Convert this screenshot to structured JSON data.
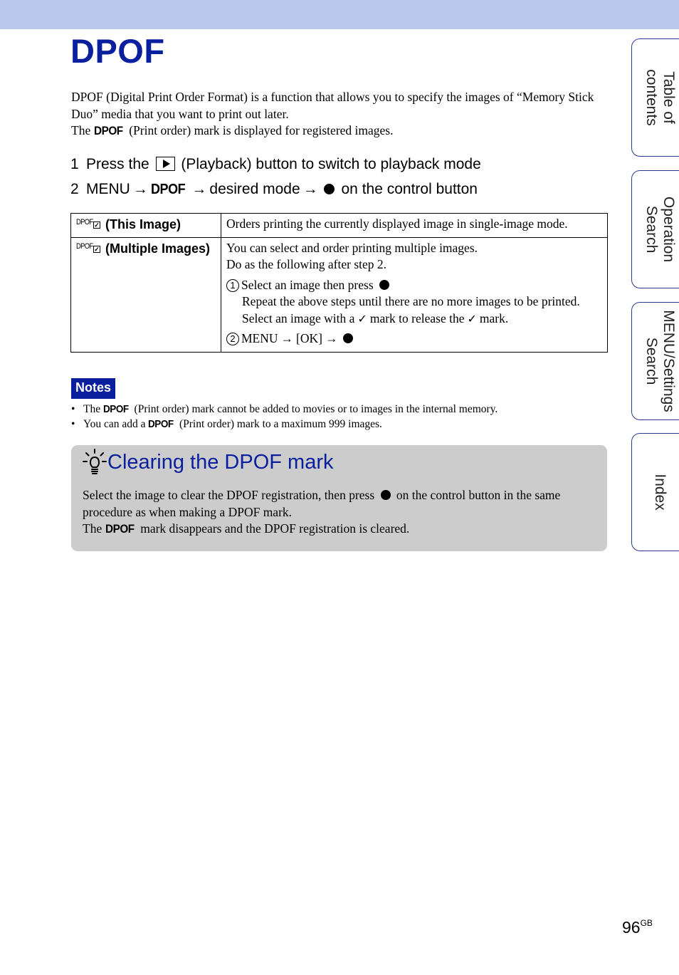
{
  "page": {
    "title": "DPOF",
    "page_number": "96",
    "page_suffix": "GB",
    "colors": {
      "header_band": "#b8c8ec",
      "title_blue": "#0a1f9e",
      "hint_box": "#cccccc"
    }
  },
  "intro": {
    "line1": "DPOF (Digital Print Order Format) is a function that allows you to specify the images of “Memory Stick Duo” media that you want to print out later.",
    "line2_before": "The ",
    "dpof_mark": "DPOF",
    "line2_after": " (Print order) mark is displayed for registered images."
  },
  "steps": [
    {
      "num": "1",
      "before": "Press the ",
      "icon": "playback-icon",
      "after": " (Playback) button to switch to playback mode"
    },
    {
      "num": "2",
      "part1": "MENU",
      "arrow": "→",
      "mark": "DPOF",
      "part2": "desired mode",
      "part3": "on the control button"
    }
  ],
  "table": {
    "rows": [
      {
        "icon_text": "DPOF",
        "name": "(This Image)",
        "desc": "Orders printing the currently displayed image in single-image mode."
      },
      {
        "icon_text": "DPOF",
        "name": "(Multiple Images)",
        "desc_line1": "You can select and order printing multiple images.",
        "desc_line2": "Do as the following after step 2.",
        "sub1_num": "1",
        "sub1_text": "Select an image then press",
        "sub1_cont_before": "Repeat the above steps until there are no more images to be printed. Select an image with a",
        "sub1_cont_mid": "mark to release the",
        "sub1_cont_after": "mark.",
        "sub2_num": "2",
        "sub2_menu": "MENU",
        "sub2_ok": "[OK]"
      }
    ]
  },
  "notes": {
    "label": "Notes",
    "items": [
      {
        "before": "The ",
        "mark": "DPOF",
        "after": " (Print order) mark cannot be added to movies or to images in the internal memory."
      },
      {
        "before": "You can add a ",
        "mark": "DPOF",
        "after": " (Print order) mark to a maximum 999 images."
      }
    ]
  },
  "hint": {
    "title": "Clearing the DPOF mark",
    "icon": "lightbulb-icon",
    "body1": "Select the image to clear the DPOF registration, then press",
    "body1_after": "on the control button in the same procedure as when making a DPOF mark.",
    "body2_before": "The ",
    "body2_mark": "DPOF",
    "body2_after": " mark disappears and the DPOF registration is cleared."
  },
  "side_tabs": [
    {
      "label_line1": "Table of",
      "label_line2": "contents"
    },
    {
      "label_line1": "Operation",
      "label_line2": "Search"
    },
    {
      "label_line1": "MENU/Settings",
      "label_line2": "Search"
    },
    {
      "label_line1": "Index",
      "label_line2": ""
    }
  ]
}
